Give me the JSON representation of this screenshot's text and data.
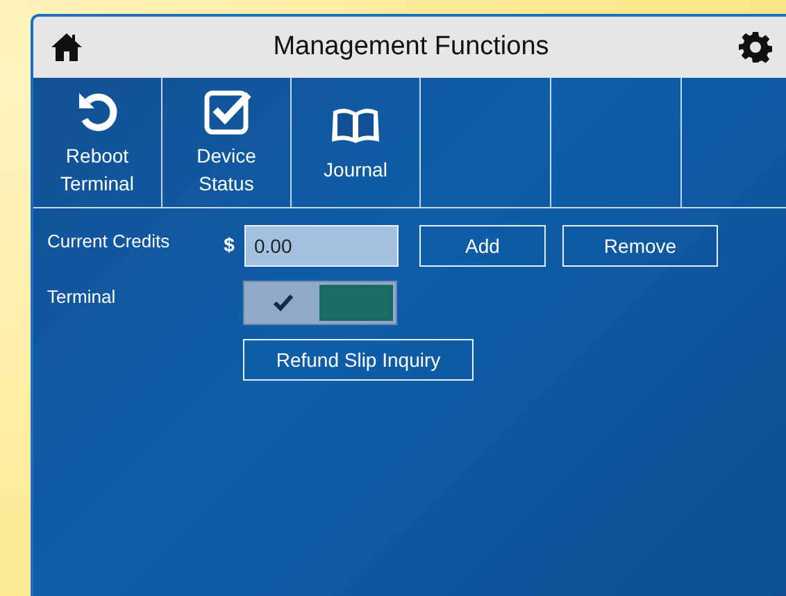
{
  "header": {
    "title": "Management Functions"
  },
  "tabs": [
    {
      "label": "Reboot\nTerminal",
      "kind": "reboot"
    },
    {
      "label": "Device\nStatus",
      "kind": "status"
    },
    {
      "label": "Journal",
      "kind": "journal"
    }
  ],
  "credits": {
    "label": "Current Credits",
    "currency": "$",
    "value": "0.00",
    "buttons": [
      "Add",
      "Remove"
    ]
  },
  "terminal": {
    "label": "Terminal",
    "checked": true
  },
  "refund_button": "Refund Slip Inquiry"
}
